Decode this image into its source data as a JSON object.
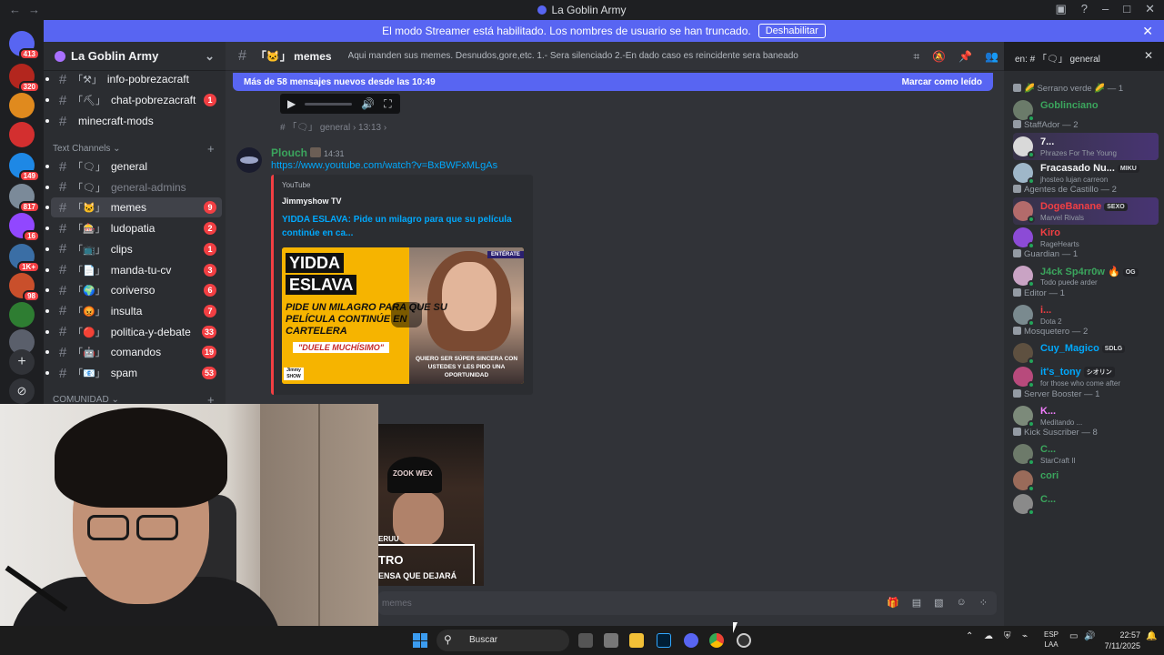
{
  "window": {
    "title": "La Goblin Army",
    "nav_back": "←",
    "nav_forward": "→"
  },
  "banner": {
    "text": "El modo Streamer está habilitado. Los nombres de usuario se han truncado.",
    "button": "Deshabilitar"
  },
  "servers": [
    {
      "badge": "413",
      "color": "#5865f2"
    },
    {
      "badge": "320",
      "color": "#b3261e"
    },
    {
      "badge": "",
      "color": "#e08a1e"
    },
    {
      "badge": "",
      "color": "#d32f2f"
    },
    {
      "badge": "149",
      "color": "#1e88e5"
    },
    {
      "badge": "817",
      "color": "#7b8a99"
    },
    {
      "badge": "16",
      "color": "#9147ff"
    },
    {
      "badge": "1K+",
      "color": "#3a6ea5"
    },
    {
      "badge": "98",
      "color": "#c94f2b"
    },
    {
      "badge": "",
      "color": "#2e7d32"
    },
    {
      "badge": "",
      "color": "#5a5f6b"
    }
  ],
  "guild": {
    "name": "La Goblin Army",
    "channels_top": [
      {
        "prefix": "「⚒」",
        "name": "info-pobrezacraft",
        "count": ""
      },
      {
        "prefix": "「⛏」",
        "name": "chat-pobrezacraft",
        "count": "1"
      },
      {
        "prefix": "",
        "name": "minecraft-mods",
        "count": ""
      }
    ],
    "category_text": "Text Channels",
    "channels": [
      {
        "prefix": "「🗨」",
        "name": "general",
        "count": "",
        "state": "normal"
      },
      {
        "prefix": "「🗨」",
        "name": "general-admins",
        "count": "",
        "state": "muted"
      },
      {
        "prefix": "「🐱」",
        "name": "memes",
        "count": "9",
        "state": "active"
      },
      {
        "prefix": "「🎰」",
        "name": "ludopatia",
        "count": "2",
        "state": "normal"
      },
      {
        "prefix": "「📺」",
        "name": "clips",
        "count": "1",
        "state": "normal"
      },
      {
        "prefix": "「📄」",
        "name": "manda-tu-cv",
        "count": "3",
        "state": "normal"
      },
      {
        "prefix": "「🌍」",
        "name": "coriverso",
        "count": "6",
        "state": "normal"
      },
      {
        "prefix": "「😡」",
        "name": "insulta",
        "count": "7",
        "state": "normal"
      },
      {
        "prefix": "「🔴」",
        "name": "politica-y-debate",
        "count": "33",
        "state": "normal"
      },
      {
        "prefix": "「🤖」",
        "name": "comandos",
        "count": "19",
        "state": "normal"
      },
      {
        "prefix": "「📧」",
        "name": "spam",
        "count": "53",
        "state": "normal"
      }
    ],
    "category_community": "COMUNIDAD"
  },
  "channel_header": {
    "name": "「🐱」 memes",
    "topic": "Aqui manden sus memes. Desnudos,gore,etc. 1.- Sera silenciado 2.-En dado caso es reincidente sera baneado",
    "search": "en: # 「🗨」 general"
  },
  "new_messages": {
    "text": "Más de 58 mensajes nuevos desde las 10:49",
    "mark": "Marcar como leído"
  },
  "reply_ref": "# 「🗨」 general › 13:13 ›",
  "message": {
    "author": "Plouch",
    "time": "14:31",
    "link": "https://www.youtube.com/watch?v=BxBWFxMLgAs",
    "embed": {
      "provider": "YouTube",
      "author": "Jimmyshow TV",
      "title": "YIDDA ESLAVA: Pide un milagro para que su película continúe en ca...",
      "thumb_line1": "YIDDA",
      "thumb_line2": "ESLAVA",
      "thumb_line3": "PIDE UN MILAGRO PARA QUE SU PELÍCULA CONTINÚE EN CARTELERA",
      "thumb_line4": "\"DUELE MUCHÍSIMO\"",
      "thumb_badge": "ENTÉRATE",
      "thumb_quote": "QUIERO SER SÚPER SINCERA CON USTEDES Y LES PIDO UNA OPORTUNIDAD",
      "thumb_logo": "Jimmy SHOW"
    }
  },
  "video2": {
    "cap_text": "ZOOK WEX",
    "label": "ERUU",
    "line1": "TRO",
    "line2": "ENSA QUE DEJARÁ"
  },
  "composer": {
    "placeholder": "memes"
  },
  "members": [
    {
      "type": "role",
      "label": "🌽 Serrano verde 🌽 — 1"
    },
    {
      "type": "member",
      "name": "Goblinciano",
      "status": "",
      "color": "#3ba55d",
      "avatar": "#6b7b6a",
      "badge": ""
    },
    {
      "type": "role",
      "label": "StaffAdor — 2"
    },
    {
      "type": "member",
      "name": "7...",
      "status": "Phrazes For The Young",
      "color": "#f2f3f5",
      "avatar": "#d9d9d9",
      "badge": "",
      "highlight": true
    },
    {
      "type": "member",
      "name": "Fracasado Nu...",
      "status": "jhosteo lujan carreon",
      "color": "#f2f3f5",
      "avatar": "#9fb7c9",
      "badge": "MIKU"
    },
    {
      "type": "role",
      "label": "Agentes de Castillo — 2"
    },
    {
      "type": "member",
      "name": "DogeBanane",
      "status": "Marvel Rivals",
      "color": "#f23f43",
      "avatar": "#b36b6b",
      "badge": "SEXO",
      "highlight": true
    },
    {
      "type": "member",
      "name": "Kiro",
      "status": "RageHearts",
      "color": "#f23f43",
      "avatar": "#8c4bd6",
      "badge": ""
    },
    {
      "type": "role",
      "label": "Guardian — 1"
    },
    {
      "type": "member",
      "name": "J4ck Sp4rr0w 🔥",
      "status": "Todo puede arder",
      "color": "#3ba55d",
      "avatar": "#c9a3c4",
      "badge": "OG"
    },
    {
      "type": "role",
      "label": "Editor — 1"
    },
    {
      "type": "member",
      "name": "i...",
      "status": "Dota 2",
      "color": "#f23f43",
      "avatar": "#7a8a8f",
      "badge": ""
    },
    {
      "type": "role",
      "label": "Mosquetero — 2"
    },
    {
      "type": "member",
      "name": "Cuy_Magico",
      "status": "",
      "color": "#00a8fc",
      "avatar": "#5e5040",
      "badge": "SDLG"
    },
    {
      "type": "member",
      "name": "it's_tony",
      "status": "for those who come after",
      "color": "#00a8fc",
      "avatar": "#b84a7c",
      "badge": "シオリン"
    },
    {
      "type": "role",
      "label": "Server Booster — 1"
    },
    {
      "type": "member",
      "name": "K...",
      "status": "Meditando ...",
      "color": "#f47fff",
      "avatar": "#7c8a7a",
      "badge": ""
    },
    {
      "type": "role",
      "label": "Kick Suscriber — 8"
    },
    {
      "type": "member",
      "name": "C...",
      "status": "StarCraft II",
      "color": "#3ba55d",
      "avatar": "#6d7a6a",
      "badge": ""
    },
    {
      "type": "member",
      "name": "cori",
      "status": "",
      "color": "#3ba55d",
      "avatar": "#9a6b5a",
      "badge": ""
    },
    {
      "type": "member",
      "name": "C...",
      "status": "",
      "color": "#3ba55d",
      "avatar": "#8a8a8a",
      "badge": ""
    }
  ],
  "taskbar": {
    "search": "Buscar",
    "lang1": "ESP",
    "lang2": "LAA",
    "time": "22:57",
    "date": "7/11/2025"
  }
}
